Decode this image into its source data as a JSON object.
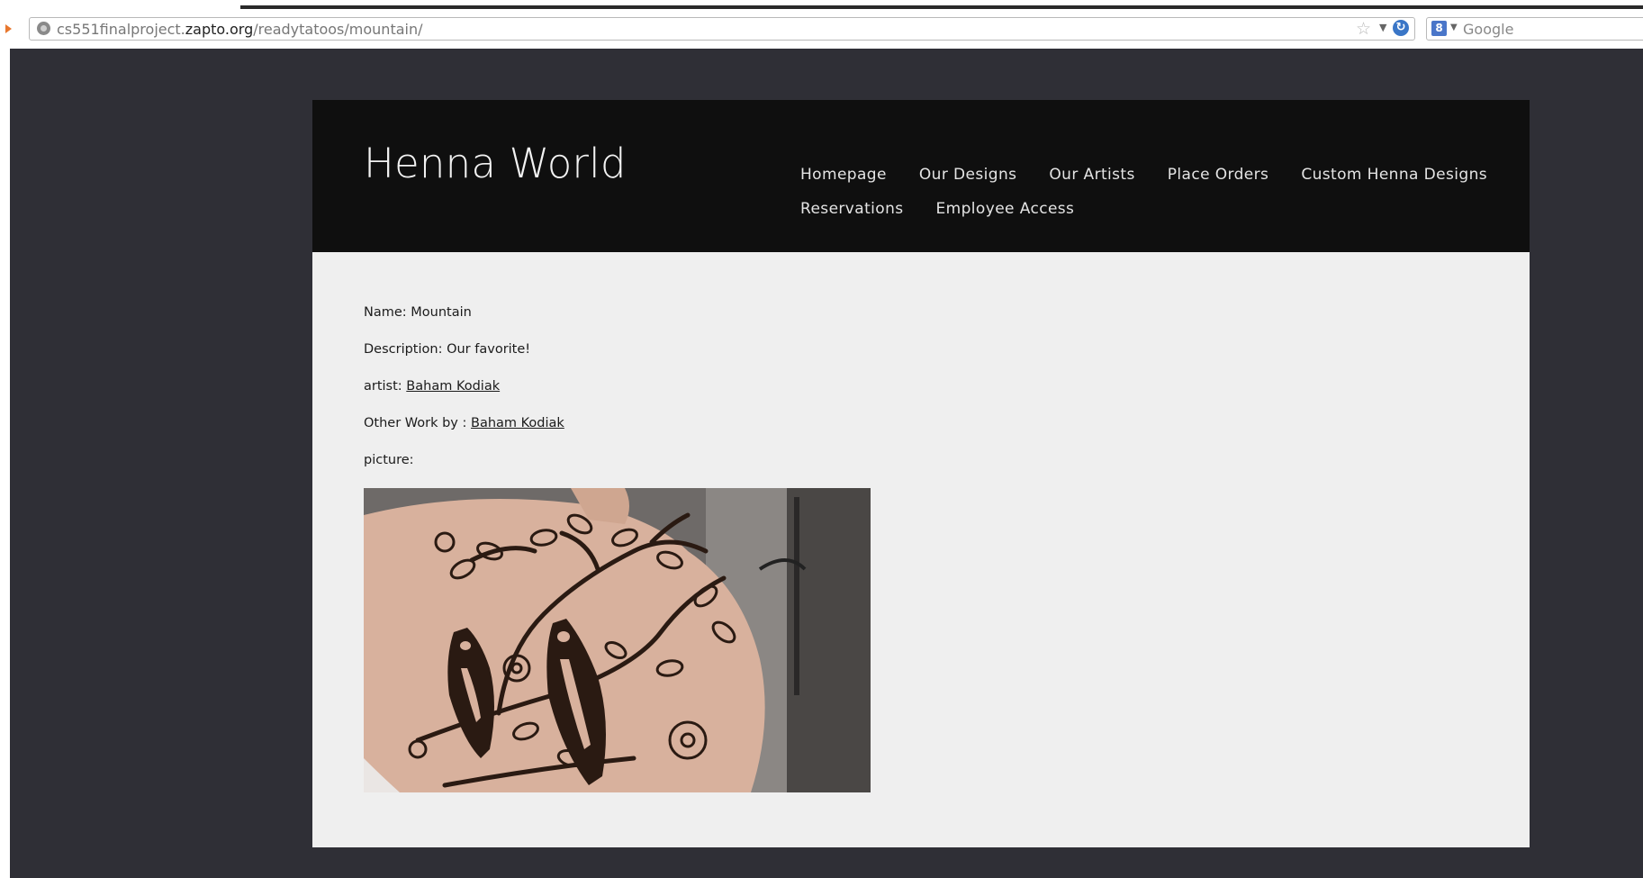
{
  "browser": {
    "url_prefix": "cs551finalproject.",
    "url_host": "zapto.org",
    "url_path": "/readytatoos/mountain/",
    "search_placeholder": "Google",
    "search_engine_letter": "8"
  },
  "site": {
    "title": "Henna World",
    "nav_row1": [
      "Homepage",
      "Our Designs",
      "Our Artists",
      "Place Orders",
      "Custom Henna Designs"
    ],
    "nav_row2": [
      "Reservations",
      "Employee Access"
    ]
  },
  "design": {
    "name_label": "Name: Mountain",
    "description_label": "Description: Our favorite!",
    "artist_label": "artist:",
    "artist_name": "Baham Kodiak",
    "other_work_label": "Other Work by :",
    "other_work_artist": "Baham Kodiak",
    "picture_label": "picture:"
  },
  "colors": {
    "background": "#2f2f36",
    "header": "#0f0f0f",
    "content": "#efefef"
  }
}
